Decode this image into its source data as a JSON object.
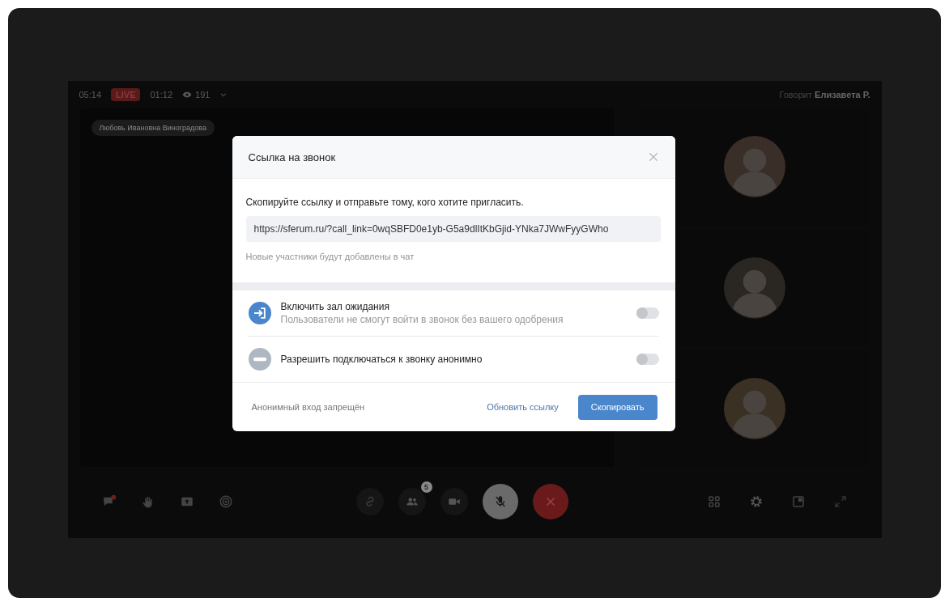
{
  "stream_bar": {
    "elapsed": "05:14",
    "live_badge": "LIVE",
    "live_time": "01:12",
    "viewers": "191"
  },
  "speaker": {
    "prefix": "Говорит",
    "name": "Елизавета Р."
  },
  "main_video": {
    "name_tag": "Любовь Ивановна Виноградова"
  },
  "participants": [
    {
      "kind": "avatar"
    },
    {
      "kind": "avatar"
    },
    {
      "kind": "avatar"
    }
  ],
  "modal": {
    "title": "Ссылка на звонок",
    "instruction": "Скопируйте ссылку и отправьте тому, кого хотите пригласить.",
    "link": "https://sferum.ru/?call_link=0wqSBFD0e1yb-G5a9dlItKbGjid-YNka7JWwFyyGWho",
    "hint": "Новые участники будут добавлены в чат",
    "options": [
      {
        "kind": "waiting_room",
        "title": "Включить зал ожидания",
        "subtitle": "Пользователи не смогут войти в звонок без вашего одобрения",
        "on": false
      },
      {
        "kind": "anonymous",
        "title": "Разрешить подключаться к звонку анонимно",
        "on": false
      }
    ],
    "status": "Анонимный вход запрещён",
    "refresh_link": "Обновить ссылку",
    "copy_button": "Скопировать"
  },
  "controls": {
    "left": [
      {
        "kind": "chat"
      },
      {
        "kind": "hand"
      },
      {
        "kind": "screen"
      },
      {
        "kind": "record"
      }
    ],
    "center": [
      {
        "kind": "link"
      },
      {
        "kind": "people",
        "badge": "5"
      },
      {
        "kind": "camera"
      },
      {
        "kind": "mic"
      },
      {
        "kind": "hangup"
      }
    ],
    "right": [
      {
        "kind": "grid"
      },
      {
        "kind": "settings"
      },
      {
        "kind": "window"
      },
      {
        "kind": "expand"
      }
    ]
  }
}
